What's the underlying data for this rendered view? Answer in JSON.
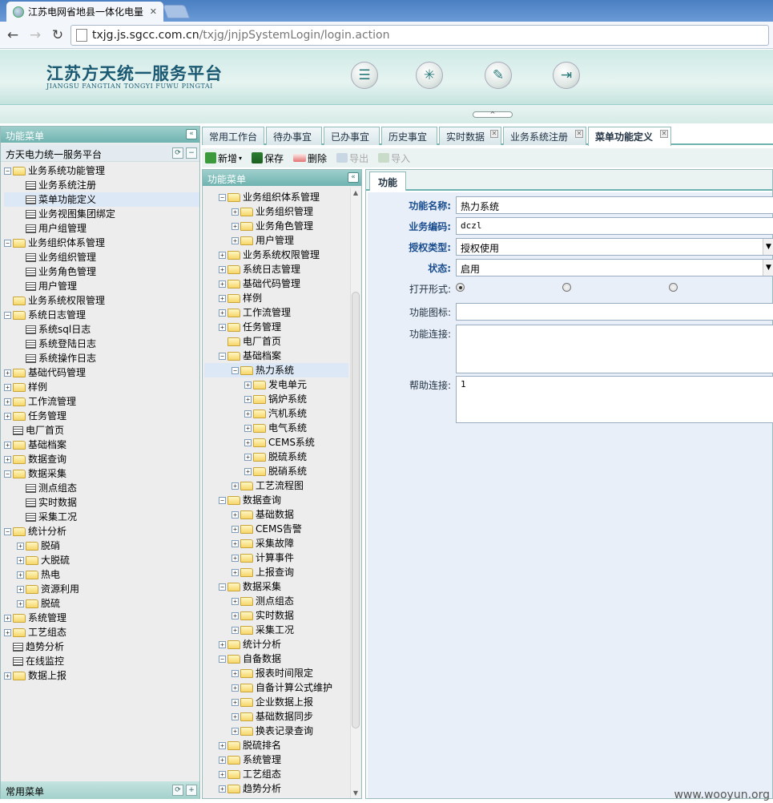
{
  "browser": {
    "tab_title": "江苏电网省地县一体化电量",
    "url_host": "txjg.js.sgcc.com.cn",
    "url_path": "/txjg/jnjpSystemLogin/login.action"
  },
  "header": {
    "title": "江苏方天统一服务平台",
    "subtitle": "JIANGSU FANGTIAN TONGYI FUWU PINGTAI"
  },
  "left_panel": {
    "title": "功能菜单",
    "subheader": "方天电力统一服务平台",
    "footer": "常用菜单",
    "items": [
      {
        "label": "业务系统功能管理",
        "level": 0,
        "type": "folder",
        "state": "open"
      },
      {
        "label": "业务系统注册",
        "level": 1,
        "type": "doc"
      },
      {
        "label": "菜单功能定义",
        "level": 1,
        "type": "doc",
        "selected": true
      },
      {
        "label": "业务视图集团绑定",
        "level": 1,
        "type": "doc"
      },
      {
        "label": "用户组管理",
        "level": 1,
        "type": "doc"
      },
      {
        "label": "业务组织体系管理",
        "level": 0,
        "type": "folder",
        "state": "open"
      },
      {
        "label": "业务组织管理",
        "level": 1,
        "type": "doc"
      },
      {
        "label": "业务角色管理",
        "level": 1,
        "type": "doc"
      },
      {
        "label": "用户管理",
        "level": 1,
        "type": "doc"
      },
      {
        "label": "业务系统权限管理",
        "level": 0,
        "type": "folder",
        "state": "leaf"
      },
      {
        "label": "系统日志管理",
        "level": 0,
        "type": "folder",
        "state": "open"
      },
      {
        "label": "系统sql日志",
        "level": 1,
        "type": "doc"
      },
      {
        "label": "系统登陆日志",
        "level": 1,
        "type": "doc"
      },
      {
        "label": "系统操作日志",
        "level": 1,
        "type": "doc"
      },
      {
        "label": "基础代码管理",
        "level": 0,
        "type": "folder",
        "state": "closed"
      },
      {
        "label": "样例",
        "level": 0,
        "type": "folder",
        "state": "closed"
      },
      {
        "label": "工作流管理",
        "level": 0,
        "type": "folder",
        "state": "closed"
      },
      {
        "label": "任务管理",
        "level": 0,
        "type": "folder",
        "state": "closed"
      },
      {
        "label": "电厂首页",
        "level": 0,
        "type": "doc"
      },
      {
        "label": "基础档案",
        "level": 0,
        "type": "folder",
        "state": "closed"
      },
      {
        "label": "数据查询",
        "level": 0,
        "type": "folder",
        "state": "closed"
      },
      {
        "label": "数据采集",
        "level": 0,
        "type": "folder",
        "state": "open"
      },
      {
        "label": "测点组态",
        "level": 1,
        "type": "doc"
      },
      {
        "label": "实时数据",
        "level": 1,
        "type": "doc"
      },
      {
        "label": "采集工况",
        "level": 1,
        "type": "doc"
      },
      {
        "label": "统计分析",
        "level": 0,
        "type": "folder",
        "state": "open"
      },
      {
        "label": "脱硝",
        "level": 1,
        "type": "folder",
        "state": "closed"
      },
      {
        "label": "大脱硫",
        "level": 1,
        "type": "folder",
        "state": "closed"
      },
      {
        "label": "热电",
        "level": 1,
        "type": "folder",
        "state": "closed"
      },
      {
        "label": "资源利用",
        "level": 1,
        "type": "folder",
        "state": "closed"
      },
      {
        "label": "脱硫",
        "level": 1,
        "type": "folder",
        "state": "closed"
      },
      {
        "label": "系统管理",
        "level": 0,
        "type": "folder",
        "state": "closed"
      },
      {
        "label": "工艺组态",
        "level": 0,
        "type": "folder",
        "state": "closed"
      },
      {
        "label": "趋势分析",
        "level": 0,
        "type": "doc"
      },
      {
        "label": "在线监控",
        "level": 0,
        "type": "doc"
      },
      {
        "label": "数据上报",
        "level": 0,
        "type": "folder",
        "state": "closed"
      }
    ]
  },
  "main_tabs": [
    {
      "label": "常用工作台",
      "closable": false
    },
    {
      "label": "待办事宜",
      "closable": false
    },
    {
      "label": "已办事宜",
      "closable": false
    },
    {
      "label": "历史事宜",
      "closable": false
    },
    {
      "label": "实时数据",
      "closable": true
    },
    {
      "label": "业务系统注册",
      "closable": true
    },
    {
      "label": "菜单功能定义",
      "closable": true,
      "active": true
    }
  ],
  "toolbar": {
    "new_label": "新增",
    "save_label": "保存",
    "delete_label": "删除",
    "export_label": "导出",
    "import_label": "导入"
  },
  "middle_panel": {
    "title": "功能菜单",
    "items": [
      {
        "label": "业务组织体系管理",
        "level": 1,
        "state": "open"
      },
      {
        "label": "业务组织管理",
        "level": 2,
        "state": "closed"
      },
      {
        "label": "业务角色管理",
        "level": 2,
        "state": "closed"
      },
      {
        "label": "用户管理",
        "level": 2,
        "state": "closed"
      },
      {
        "label": "业务系统权限管理",
        "level": 1,
        "state": "closed"
      },
      {
        "label": "系统日志管理",
        "level": 1,
        "state": "closed"
      },
      {
        "label": "基础代码管理",
        "level": 1,
        "state": "closed"
      },
      {
        "label": "样例",
        "level": 1,
        "state": "closed"
      },
      {
        "label": "工作流管理",
        "level": 1,
        "state": "closed"
      },
      {
        "label": "任务管理",
        "level": 1,
        "state": "closed"
      },
      {
        "label": "电厂首页",
        "level": 1,
        "state": "leaf"
      },
      {
        "label": "基础档案",
        "level": 1,
        "state": "open"
      },
      {
        "label": "热力系统",
        "level": 2,
        "state": "open",
        "selected": true
      },
      {
        "label": "发电单元",
        "level": 3,
        "state": "closed"
      },
      {
        "label": "锅炉系统",
        "level": 3,
        "state": "closed"
      },
      {
        "label": "汽机系统",
        "level": 3,
        "state": "closed"
      },
      {
        "label": "电气系统",
        "level": 3,
        "state": "closed"
      },
      {
        "label": "CEMS系统",
        "level": 3,
        "state": "closed"
      },
      {
        "label": "脱硫系统",
        "level": 3,
        "state": "closed"
      },
      {
        "label": "脱硝系统",
        "level": 3,
        "state": "closed"
      },
      {
        "label": "工艺流程图",
        "level": 2,
        "state": "closed"
      },
      {
        "label": "数据查询",
        "level": 1,
        "state": "open"
      },
      {
        "label": "基础数据",
        "level": 2,
        "state": "closed"
      },
      {
        "label": "CEMS告警",
        "level": 2,
        "state": "closed"
      },
      {
        "label": "采集故障",
        "level": 2,
        "state": "closed"
      },
      {
        "label": "计算事件",
        "level": 2,
        "state": "closed"
      },
      {
        "label": "上报查询",
        "level": 2,
        "state": "closed"
      },
      {
        "label": "数据采集",
        "level": 1,
        "state": "open"
      },
      {
        "label": "测点组态",
        "level": 2,
        "state": "closed"
      },
      {
        "label": "实时数据",
        "level": 2,
        "state": "closed"
      },
      {
        "label": "采集工况",
        "level": 2,
        "state": "closed"
      },
      {
        "label": "统计分析",
        "level": 1,
        "state": "closed"
      },
      {
        "label": "自备数据",
        "level": 1,
        "state": "open"
      },
      {
        "label": "报表时间限定",
        "level": 2,
        "state": "closed"
      },
      {
        "label": "自备计算公式维护",
        "level": 2,
        "state": "closed"
      },
      {
        "label": "企业数据上报",
        "level": 2,
        "state": "closed"
      },
      {
        "label": "基础数据同步",
        "level": 2,
        "state": "closed"
      },
      {
        "label": "换表记录查询",
        "level": 2,
        "state": "closed"
      },
      {
        "label": "脱硫排名",
        "level": 1,
        "state": "closed"
      },
      {
        "label": "系统管理",
        "level": 1,
        "state": "closed"
      },
      {
        "label": "工艺组态",
        "level": 1,
        "state": "closed"
      },
      {
        "label": "趋势分析",
        "level": 1,
        "state": "closed"
      }
    ]
  },
  "form": {
    "tab": "功能",
    "name_label": "功能名称:",
    "name_value": "热力系统",
    "code_label": "业务编码:",
    "code_value": "dczl",
    "auth_label": "授权类型:",
    "auth_value": "授权使用",
    "status_label": "状态:",
    "status_value": "启用",
    "open_label": "打开形式:",
    "icon_label": "功能图标:",
    "icon_value": "",
    "link_label": "功能连接:",
    "link_value": "",
    "help_label": "帮助连接:",
    "help_value": "1"
  },
  "watermark": "www.wooyun.org"
}
